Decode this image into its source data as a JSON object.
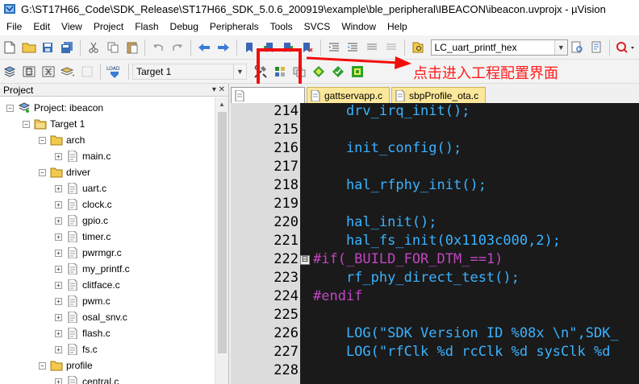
{
  "window": {
    "title": "G:\\ST17H66_Code\\SDK_Release\\ST17H66_SDK_5.0.6_200919\\example\\ble_peripheral\\IBEACON\\ibeacon.uvprojx - µVision"
  },
  "menu": [
    "File",
    "Edit",
    "View",
    "Project",
    "Flash",
    "Debug",
    "Peripherals",
    "Tools",
    "SVCS",
    "Window",
    "Help"
  ],
  "toolbar1": {
    "find_combo_value": "LC_uart_printf_hex"
  },
  "toolbar2": {
    "target_combo_value": "Target 1",
    "load_label": "LOAD"
  },
  "annotation": {
    "text": "点击进入工程配置界面",
    "color": "#ff1a1a"
  },
  "project_panel": {
    "title": "Project",
    "pin": "▾ ✕",
    "root": "Project: ibeacon",
    "target": "Target 1",
    "groups": [
      {
        "name": "arch",
        "files": [
          "main.c"
        ]
      },
      {
        "name": "driver",
        "files": [
          "uart.c",
          "clock.c",
          "gpio.c",
          "timer.c",
          "pwrmgr.c",
          "my_printf.c",
          "clitface.c",
          "pwm.c",
          "osal_snv.c",
          "flash.c",
          "fs.c"
        ]
      },
      {
        "name": "profile",
        "files": [
          "central.c"
        ]
      }
    ]
  },
  "editor_tabs": [
    {
      "label": "",
      "active": true
    },
    {
      "label": "gattservapp.c",
      "active": false
    },
    {
      "label": "sbpProfile_ota.c",
      "active": false
    }
  ],
  "code_lines": [
    {
      "num": "214",
      "text": "    drv_irq_init();",
      "type": "code"
    },
    {
      "num": "215",
      "text": "",
      "type": "code"
    },
    {
      "num": "216",
      "text": "    init_config();",
      "type": "code"
    },
    {
      "num": "217",
      "text": "",
      "type": "code"
    },
    {
      "num": "218",
      "text": "    hal_rfphy_init();",
      "type": "code"
    },
    {
      "num": "219",
      "text": "",
      "type": "code"
    },
    {
      "num": "220",
      "text": "    hal_init();",
      "type": "code"
    },
    {
      "num": "221",
      "text": "    hal_fs_init(0x1103c000,2);",
      "type": "code"
    },
    {
      "num": "222",
      "text": "#if(_BUILD_FOR_DTM_==1)",
      "type": "pp",
      "fold": "⊟"
    },
    {
      "num": "223",
      "text": "    rf_phy_direct_test();",
      "type": "code"
    },
    {
      "num": "224",
      "text": "#endif",
      "type": "pp"
    },
    {
      "num": "225",
      "text": "",
      "type": "code"
    },
    {
      "num": "226",
      "text": "    LOG(\"SDK Version ID %08x \\n\",SDK_",
      "type": "code"
    },
    {
      "num": "227",
      "text": "    LOG(\"rfClk %d rcClk %d sysClk %d",
      "type": "code"
    },
    {
      "num": "228",
      "text": "",
      "type": "code"
    }
  ],
  "colors": {
    "editor_bg": "#1a1a1a",
    "code": "#3ab2ff",
    "preprocessor": "#c246c2",
    "gutter": "#dcdcdc",
    "highlight_box": "#f20d0d"
  }
}
